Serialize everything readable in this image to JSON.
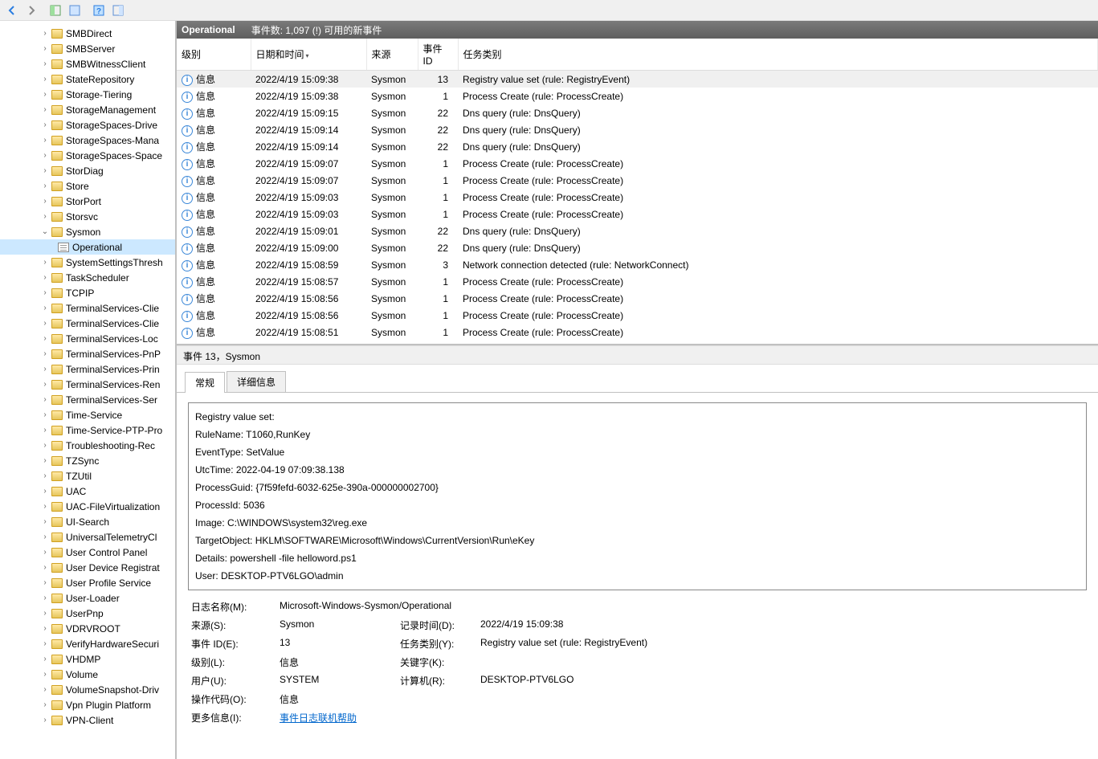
{
  "toolbar_icons": [
    "back-icon",
    "forward-icon",
    "new-icon",
    "view-icon",
    "help-icon",
    "refresh-icon"
  ],
  "sidebar": {
    "items": [
      {
        "label": "SMBDirect",
        "type": "folder"
      },
      {
        "label": "SMBServer",
        "type": "folder"
      },
      {
        "label": "SMBWitnessClient",
        "type": "folder"
      },
      {
        "label": "StateRepository",
        "type": "folder"
      },
      {
        "label": "Storage-Tiering",
        "type": "folder"
      },
      {
        "label": "StorageManagement",
        "type": "folder"
      },
      {
        "label": "StorageSpaces-Drive",
        "type": "folder"
      },
      {
        "label": "StorageSpaces-Mana",
        "type": "folder"
      },
      {
        "label": "StorageSpaces-Space",
        "type": "folder"
      },
      {
        "label": "StorDiag",
        "type": "folder"
      },
      {
        "label": "Store",
        "type": "folder"
      },
      {
        "label": "StorPort",
        "type": "folder"
      },
      {
        "label": "Storsvc",
        "type": "folder"
      },
      {
        "label": "Sysmon",
        "type": "folder",
        "expanded": true,
        "children": [
          {
            "label": "Operational",
            "type": "log",
            "selected": true
          }
        ]
      },
      {
        "label": "SystemSettingsThresh",
        "type": "folder"
      },
      {
        "label": "TaskScheduler",
        "type": "folder"
      },
      {
        "label": "TCPIP",
        "type": "folder"
      },
      {
        "label": "TerminalServices-Clie",
        "type": "folder"
      },
      {
        "label": "TerminalServices-Clie",
        "type": "folder"
      },
      {
        "label": "TerminalServices-Loc",
        "type": "folder"
      },
      {
        "label": "TerminalServices-PnP",
        "type": "folder"
      },
      {
        "label": "TerminalServices-Prin",
        "type": "folder"
      },
      {
        "label": "TerminalServices-Ren",
        "type": "folder"
      },
      {
        "label": "TerminalServices-Ser",
        "type": "folder"
      },
      {
        "label": "Time-Service",
        "type": "folder"
      },
      {
        "label": "Time-Service-PTP-Pro",
        "type": "folder"
      },
      {
        "label": "Troubleshooting-Rec",
        "type": "folder"
      },
      {
        "label": "TZSync",
        "type": "folder"
      },
      {
        "label": "TZUtil",
        "type": "folder"
      },
      {
        "label": "UAC",
        "type": "folder"
      },
      {
        "label": "UAC-FileVirtualization",
        "type": "folder"
      },
      {
        "label": "UI-Search",
        "type": "folder"
      },
      {
        "label": "UniversalTelemetryCl",
        "type": "folder"
      },
      {
        "label": "User Control Panel",
        "type": "folder"
      },
      {
        "label": "User Device Registrat",
        "type": "folder"
      },
      {
        "label": "User Profile Service",
        "type": "folder"
      },
      {
        "label": "User-Loader",
        "type": "folder"
      },
      {
        "label": "UserPnp",
        "type": "folder"
      },
      {
        "label": "VDRVROOT",
        "type": "folder"
      },
      {
        "label": "VerifyHardwareSecuri",
        "type": "folder"
      },
      {
        "label": "VHDMP",
        "type": "folder"
      },
      {
        "label": "Volume",
        "type": "folder"
      },
      {
        "label": "VolumeSnapshot-Driv",
        "type": "folder"
      },
      {
        "label": "Vpn Plugin Platform",
        "type": "folder"
      },
      {
        "label": "VPN-Client",
        "type": "folder"
      }
    ]
  },
  "events_header": {
    "title": "Operational",
    "count": "事件数: 1,097 (!) 可用的新事件"
  },
  "columns": {
    "level": "级别",
    "date": "日期和时间",
    "source": "来源",
    "id": "事件 ID",
    "task": "任务类别"
  },
  "level_info": "信息",
  "events": [
    {
      "date": "2022/4/19 15:09:38",
      "source": "Sysmon",
      "id": "13",
      "task": "Registry value set (rule: RegistryEvent)",
      "sel": true
    },
    {
      "date": "2022/4/19 15:09:38",
      "source": "Sysmon",
      "id": "1",
      "task": "Process Create (rule: ProcessCreate)"
    },
    {
      "date": "2022/4/19 15:09:15",
      "source": "Sysmon",
      "id": "22",
      "task": "Dns query (rule: DnsQuery)"
    },
    {
      "date": "2022/4/19 15:09:14",
      "source": "Sysmon",
      "id": "22",
      "task": "Dns query (rule: DnsQuery)"
    },
    {
      "date": "2022/4/19 15:09:14",
      "source": "Sysmon",
      "id": "22",
      "task": "Dns query (rule: DnsQuery)"
    },
    {
      "date": "2022/4/19 15:09:07",
      "source": "Sysmon",
      "id": "1",
      "task": "Process Create (rule: ProcessCreate)"
    },
    {
      "date": "2022/4/19 15:09:07",
      "source": "Sysmon",
      "id": "1",
      "task": "Process Create (rule: ProcessCreate)"
    },
    {
      "date": "2022/4/19 15:09:03",
      "source": "Sysmon",
      "id": "1",
      "task": "Process Create (rule: ProcessCreate)"
    },
    {
      "date": "2022/4/19 15:09:03",
      "source": "Sysmon",
      "id": "1",
      "task": "Process Create (rule: ProcessCreate)"
    },
    {
      "date": "2022/4/19 15:09:01",
      "source": "Sysmon",
      "id": "22",
      "task": "Dns query (rule: DnsQuery)"
    },
    {
      "date": "2022/4/19 15:09:00",
      "source": "Sysmon",
      "id": "22",
      "task": "Dns query (rule: DnsQuery)"
    },
    {
      "date": "2022/4/19 15:08:59",
      "source": "Sysmon",
      "id": "3",
      "task": "Network connection detected (rule: NetworkConnect)"
    },
    {
      "date": "2022/4/19 15:08:57",
      "source": "Sysmon",
      "id": "1",
      "task": "Process Create (rule: ProcessCreate)"
    },
    {
      "date": "2022/4/19 15:08:56",
      "source": "Sysmon",
      "id": "1",
      "task": "Process Create (rule: ProcessCreate)"
    },
    {
      "date": "2022/4/19 15:08:56",
      "source": "Sysmon",
      "id": "1",
      "task": "Process Create (rule: ProcessCreate)"
    },
    {
      "date": "2022/4/19 15:08:51",
      "source": "Sysmon",
      "id": "1",
      "task": "Process Create (rule: ProcessCreate)"
    }
  ],
  "detail_header": "事件 13，Sysmon",
  "tabs": {
    "general": "常规",
    "details": "详细信息"
  },
  "detail_lines": [
    "Registry value set:",
    "RuleName: T1060,RunKey",
    "EventType: SetValue",
    "UtcTime: 2022-04-19 07:09:38.138",
    "ProcessGuid: {7f59fefd-6032-625e-390a-000000002700}",
    "ProcessId: 5036",
    "Image: C:\\WINDOWS\\system32\\reg.exe",
    "TargetObject: HKLM\\SOFTWARE\\Microsoft\\Windows\\CurrentVersion\\Run\\eKey",
    "Details: powershell -file helloword.ps1",
    "User: DESKTOP-PTV6LGO\\admin"
  ],
  "meta": {
    "logname_lbl": "日志名称(M):",
    "logname_val": "Microsoft-Windows-Sysmon/Operational",
    "source_lbl": "来源(S):",
    "source_val": "Sysmon",
    "logged_lbl": "记录时间(D):",
    "logged_val": "2022/4/19 15:09:38",
    "eventid_lbl": "事件 ID(E):",
    "eventid_val": "13",
    "taskcat_lbl": "任务类别(Y):",
    "taskcat_val": "Registry value set (rule: RegistryEvent)",
    "level_lbl": "级别(L):",
    "level_val": "信息",
    "keywords_lbl": "关键字(K):",
    "keywords_val": "",
    "user_lbl": "用户(U):",
    "user_val": "SYSTEM",
    "computer_lbl": "计算机(R):",
    "computer_val": "DESKTOP-PTV6LGO",
    "opcode_lbl": "操作代码(O):",
    "opcode_val": "信息",
    "moreinfo_lbl": "更多信息(I):",
    "moreinfo_val": "事件日志联机帮助"
  }
}
